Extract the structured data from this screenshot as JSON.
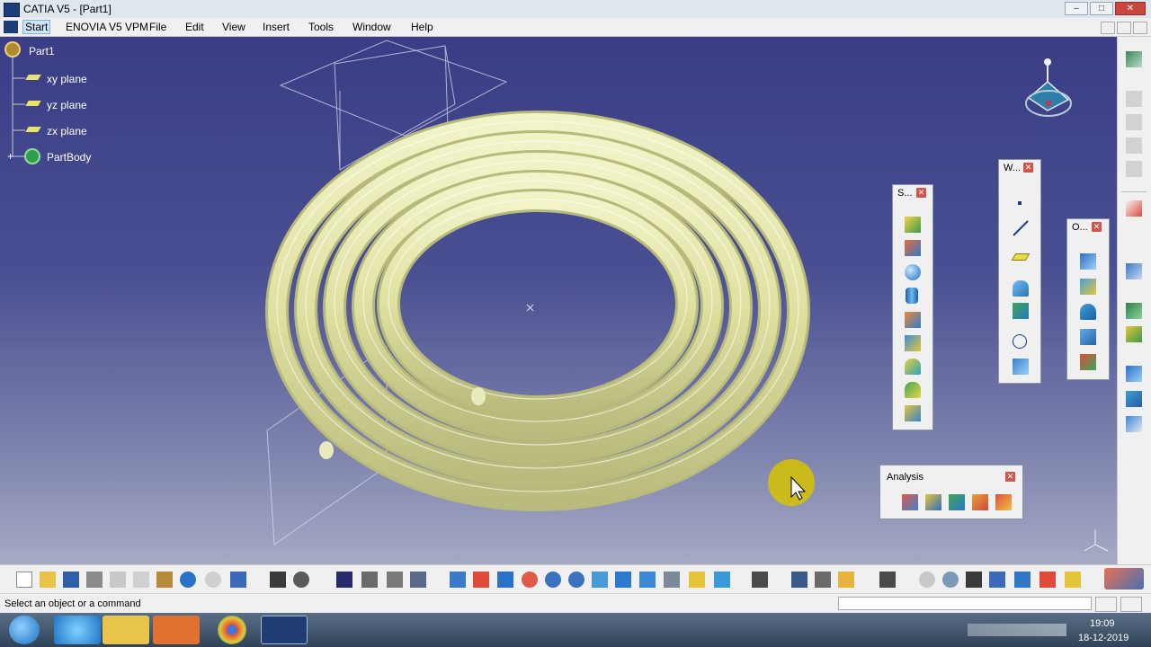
{
  "window": {
    "title": "CATIA V5 - [Part1]",
    "controls": [
      "–",
      "□",
      "✕"
    ]
  },
  "menu": {
    "items": [
      "Start",
      "ENOVIA V5 VPM",
      "File",
      "Edit",
      "View",
      "Insert",
      "Tools",
      "Window",
      "Help"
    ]
  },
  "tree": {
    "root": "Part1",
    "children": [
      "xy plane",
      "yz plane",
      "zx plane",
      "PartBody"
    ]
  },
  "toolbars": {
    "surfaces_caption": "S...",
    "wireframe_caption": "W...",
    "operations_caption": "O...",
    "analysis_caption": "Analysis",
    "close_glyph": "✕"
  },
  "status": {
    "message": "Select an object or a command"
  },
  "taskbar": {
    "time": "19:09",
    "date": "18-12-2019"
  },
  "colors": {
    "viewport_top": "#3a3d85",
    "viewport_bottom": "#a6aac4",
    "coil": "#e4e6ad",
    "tree_text": "#ffffff",
    "cursor_highlight": "#d6c200"
  },
  "icons": {
    "tree_part": "gear-icon",
    "tree_plane": "plane-icon",
    "tree_body": "partbody-icon",
    "compass": "compass-icon",
    "cursor": "mouse-cursor-icon"
  }
}
